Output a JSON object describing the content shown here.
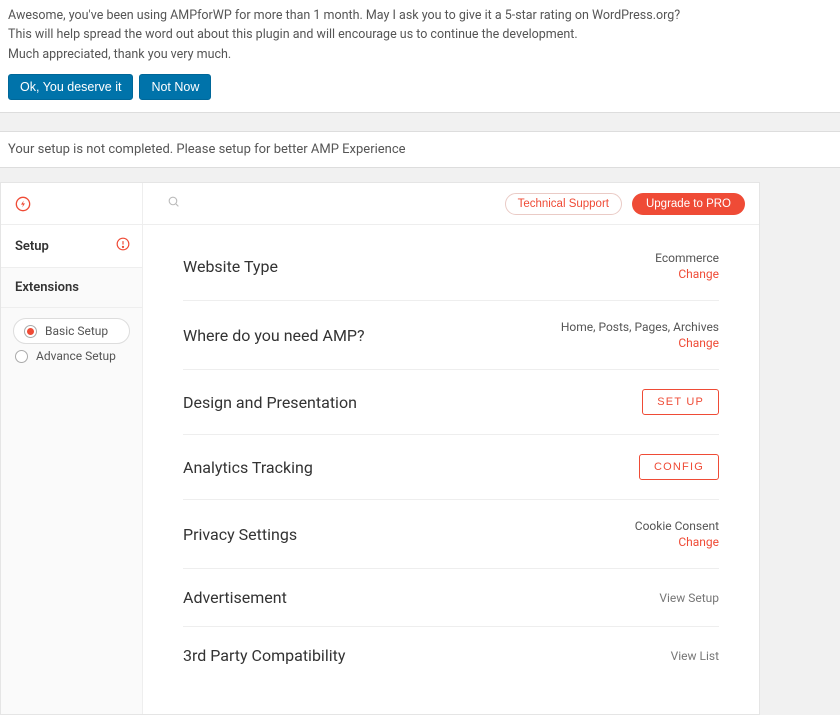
{
  "banner1": {
    "line1": "Awesome, you've been using AMPforWP for more than 1 month. May I ask you to give it a 5-star rating on WordPress.org?",
    "line2": "This will help spread the word out about this plugin and will encourage us to continue the development.",
    "line3": "Much appreciated, thank you very much.",
    "ok": "Ok, You deserve it",
    "notnow": "Not Now"
  },
  "banner2": {
    "text": "Your setup is not completed. Please setup for better AMP Experience"
  },
  "sidebar": {
    "setup": "Setup",
    "extensions": "Extensions",
    "basic": "Basic Setup",
    "advance": "Advance Setup"
  },
  "topbar": {
    "support": "Technical Support",
    "upgrade": "Upgrade to PRO"
  },
  "rows": {
    "website_type": {
      "title": "Website Type",
      "value": "Ecommerce",
      "action": "Change"
    },
    "where_amp": {
      "title": "Where do you need AMP?",
      "value": "Home, Posts, Pages, Archives",
      "action": "Change"
    },
    "design": {
      "title": "Design and Presentation",
      "action": "SET UP"
    },
    "analytics": {
      "title": "Analytics Tracking",
      "action": "CONFIG"
    },
    "privacy": {
      "title": "Privacy Settings",
      "value": "Cookie Consent",
      "action": "Change"
    },
    "advertisement": {
      "title": "Advertisement",
      "action": "View Setup"
    },
    "thirdparty": {
      "title": "3rd Party Compatibility",
      "action": "View List"
    }
  }
}
